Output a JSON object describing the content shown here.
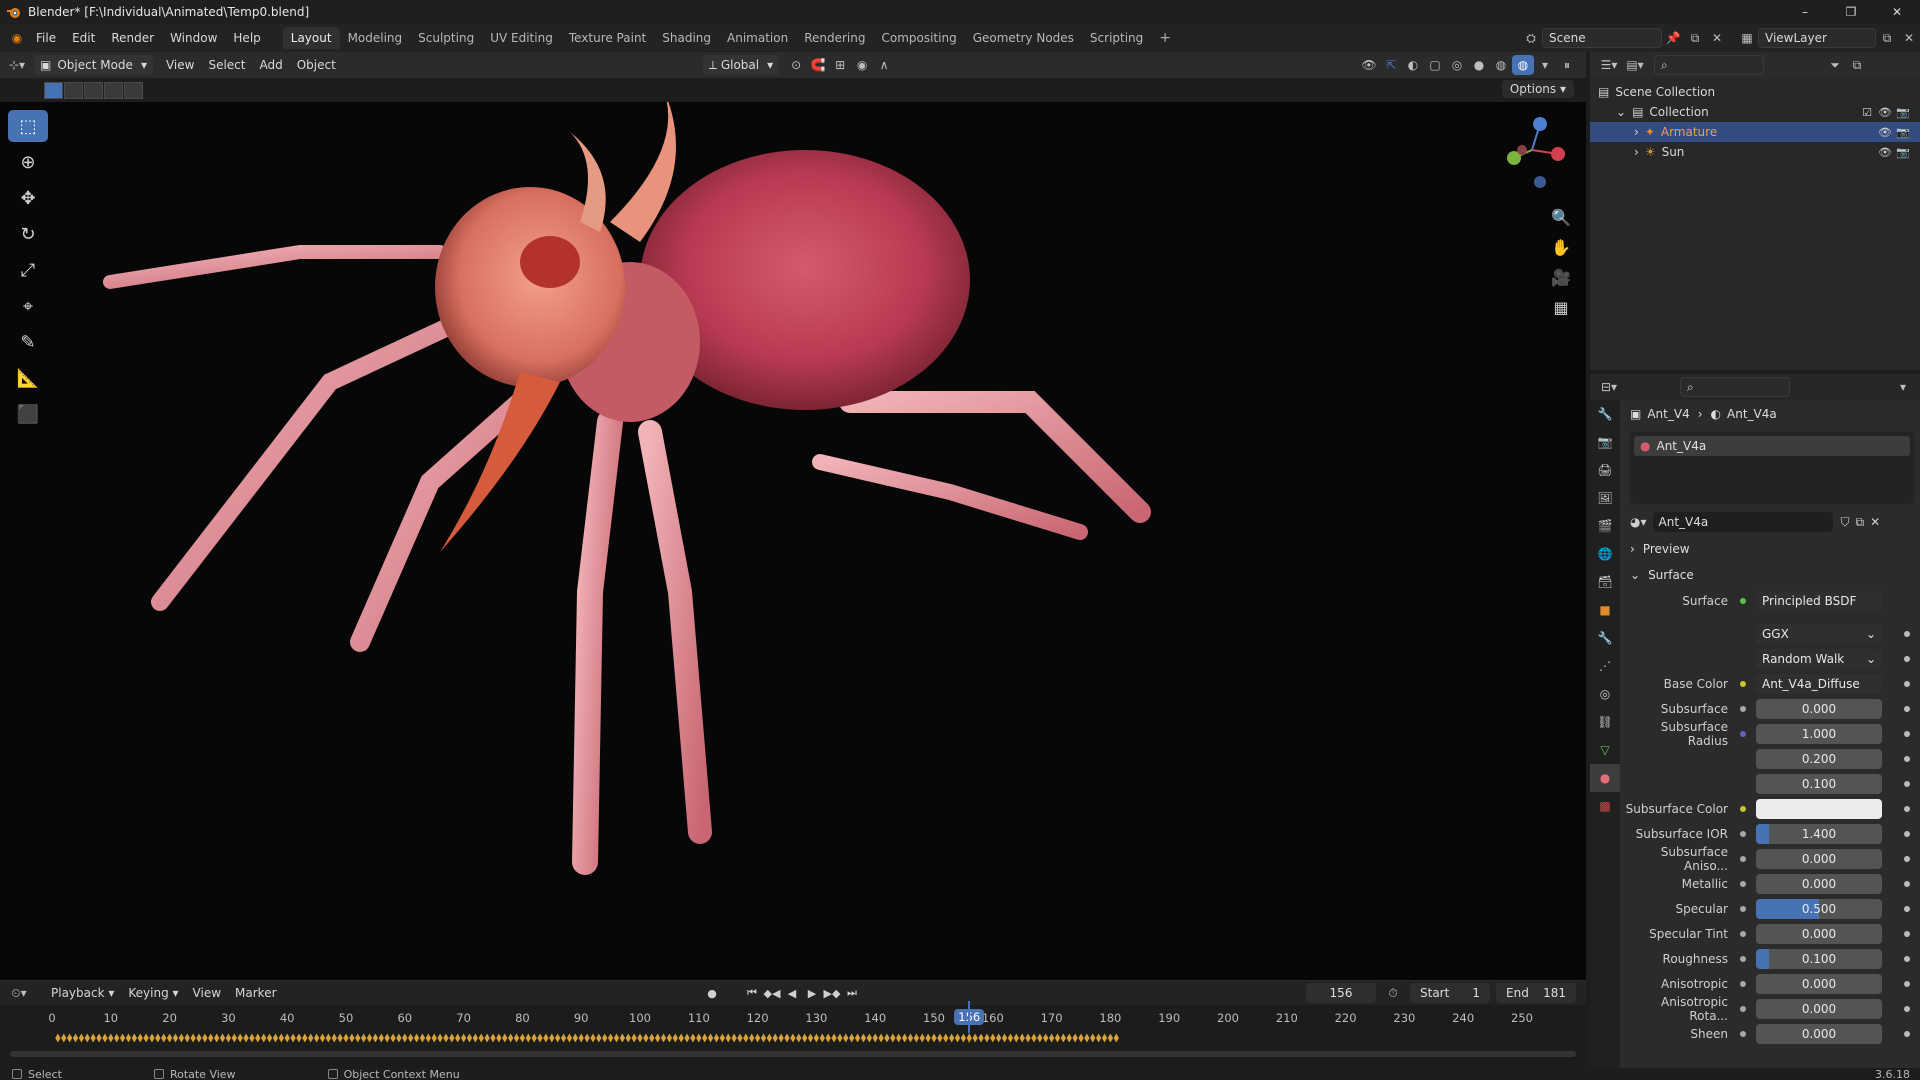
{
  "window": {
    "title": "Blender* [F:\\Individual\\Animated\\Temp0.blend]",
    "controls": [
      "–",
      "❐",
      "✕"
    ]
  },
  "menus": [
    "File",
    "Edit",
    "Render",
    "Window",
    "Help"
  ],
  "workspaces": [
    "Layout",
    "Modeling",
    "Sculpting",
    "UV Editing",
    "Texture Paint",
    "Shading",
    "Animation",
    "Rendering",
    "Compositing",
    "Geometry Nodes",
    "Scripting"
  ],
  "active_workspace": "Layout",
  "scene": {
    "name": "Scene",
    "view_layer": "ViewLayer"
  },
  "viewport_header": {
    "mode": "Object Mode",
    "menus": [
      "View",
      "Select",
      "Add",
      "Object"
    ],
    "transform_orientation": "Global",
    "options_label": "Options"
  },
  "outliner": {
    "rows": [
      {
        "label": "Scene Collection",
        "depth": 0
      },
      {
        "label": "Collection",
        "depth": 1
      },
      {
        "label": "Armature",
        "depth": 2,
        "selected": true
      },
      {
        "label": "Sun",
        "depth": 2
      }
    ]
  },
  "properties": {
    "breadcrumb_object": "Ant_V4",
    "breadcrumb_material": "Ant_V4a",
    "slot_name": "Ant_V4a",
    "material_name": "Ant_V4a",
    "preview_label": "Preview",
    "surface_panel_label": "Surface",
    "surface_label": "Surface",
    "surface_shader": "Principled BSDF",
    "distribution": "GGX",
    "subsurface_method": "Random Walk",
    "params": [
      {
        "label": "Base Color",
        "value": "Ant_V4a_Diffuse",
        "kind": "link"
      },
      {
        "label": "Subsurface",
        "value": "0.000",
        "fill": 0
      },
      {
        "label": "Subsurface Radius",
        "value": "1.000",
        "fill": 0
      },
      {
        "label": "",
        "value": "0.200",
        "fill": 0
      },
      {
        "label": "",
        "value": "0.100",
        "fill": 0
      },
      {
        "label": "Subsurface Color",
        "value": "",
        "kind": "color"
      },
      {
        "label": "Subsurface IOR",
        "value": "1.400",
        "fill": 0.1
      },
      {
        "label": "Subsurface Aniso...",
        "value": "0.000",
        "fill": 0
      },
      {
        "label": "Metallic",
        "value": "0.000",
        "fill": 0
      },
      {
        "label": "Specular",
        "value": "0.500",
        "fill": 0.5
      },
      {
        "label": "Specular Tint",
        "value": "0.000",
        "fill": 0
      },
      {
        "label": "Roughness",
        "value": "0.100",
        "fill": 0.1
      },
      {
        "label": "Anisotropic",
        "value": "0.000",
        "fill": 0
      },
      {
        "label": "Anisotropic Rota...",
        "value": "0.000",
        "fill": 0
      },
      {
        "label": "Sheen",
        "value": "0.000",
        "fill": 0
      }
    ]
  },
  "timeline": {
    "menus": [
      "Playback",
      "Keying",
      "View",
      "Marker"
    ],
    "current_frame": "156",
    "start_label": "Start",
    "start": "1",
    "end_label": "End",
    "end": "181",
    "ticks": [
      "0",
      "10",
      "20",
      "30",
      "40",
      "50",
      "60",
      "70",
      "80",
      "90",
      "100",
      "110",
      "120",
      "130",
      "140",
      "150",
      "160",
      "170",
      "180",
      "190",
      "200",
      "210",
      "220",
      "230",
      "240",
      "250"
    ]
  },
  "statusbar": {
    "items": [
      "Select",
      "Rotate View",
      "Object Context Menu"
    ],
    "version": "3.6.18"
  },
  "colors": {
    "accent": "#4772b3",
    "selection": "#334d80",
    "keyframe": "#d9a13a"
  }
}
